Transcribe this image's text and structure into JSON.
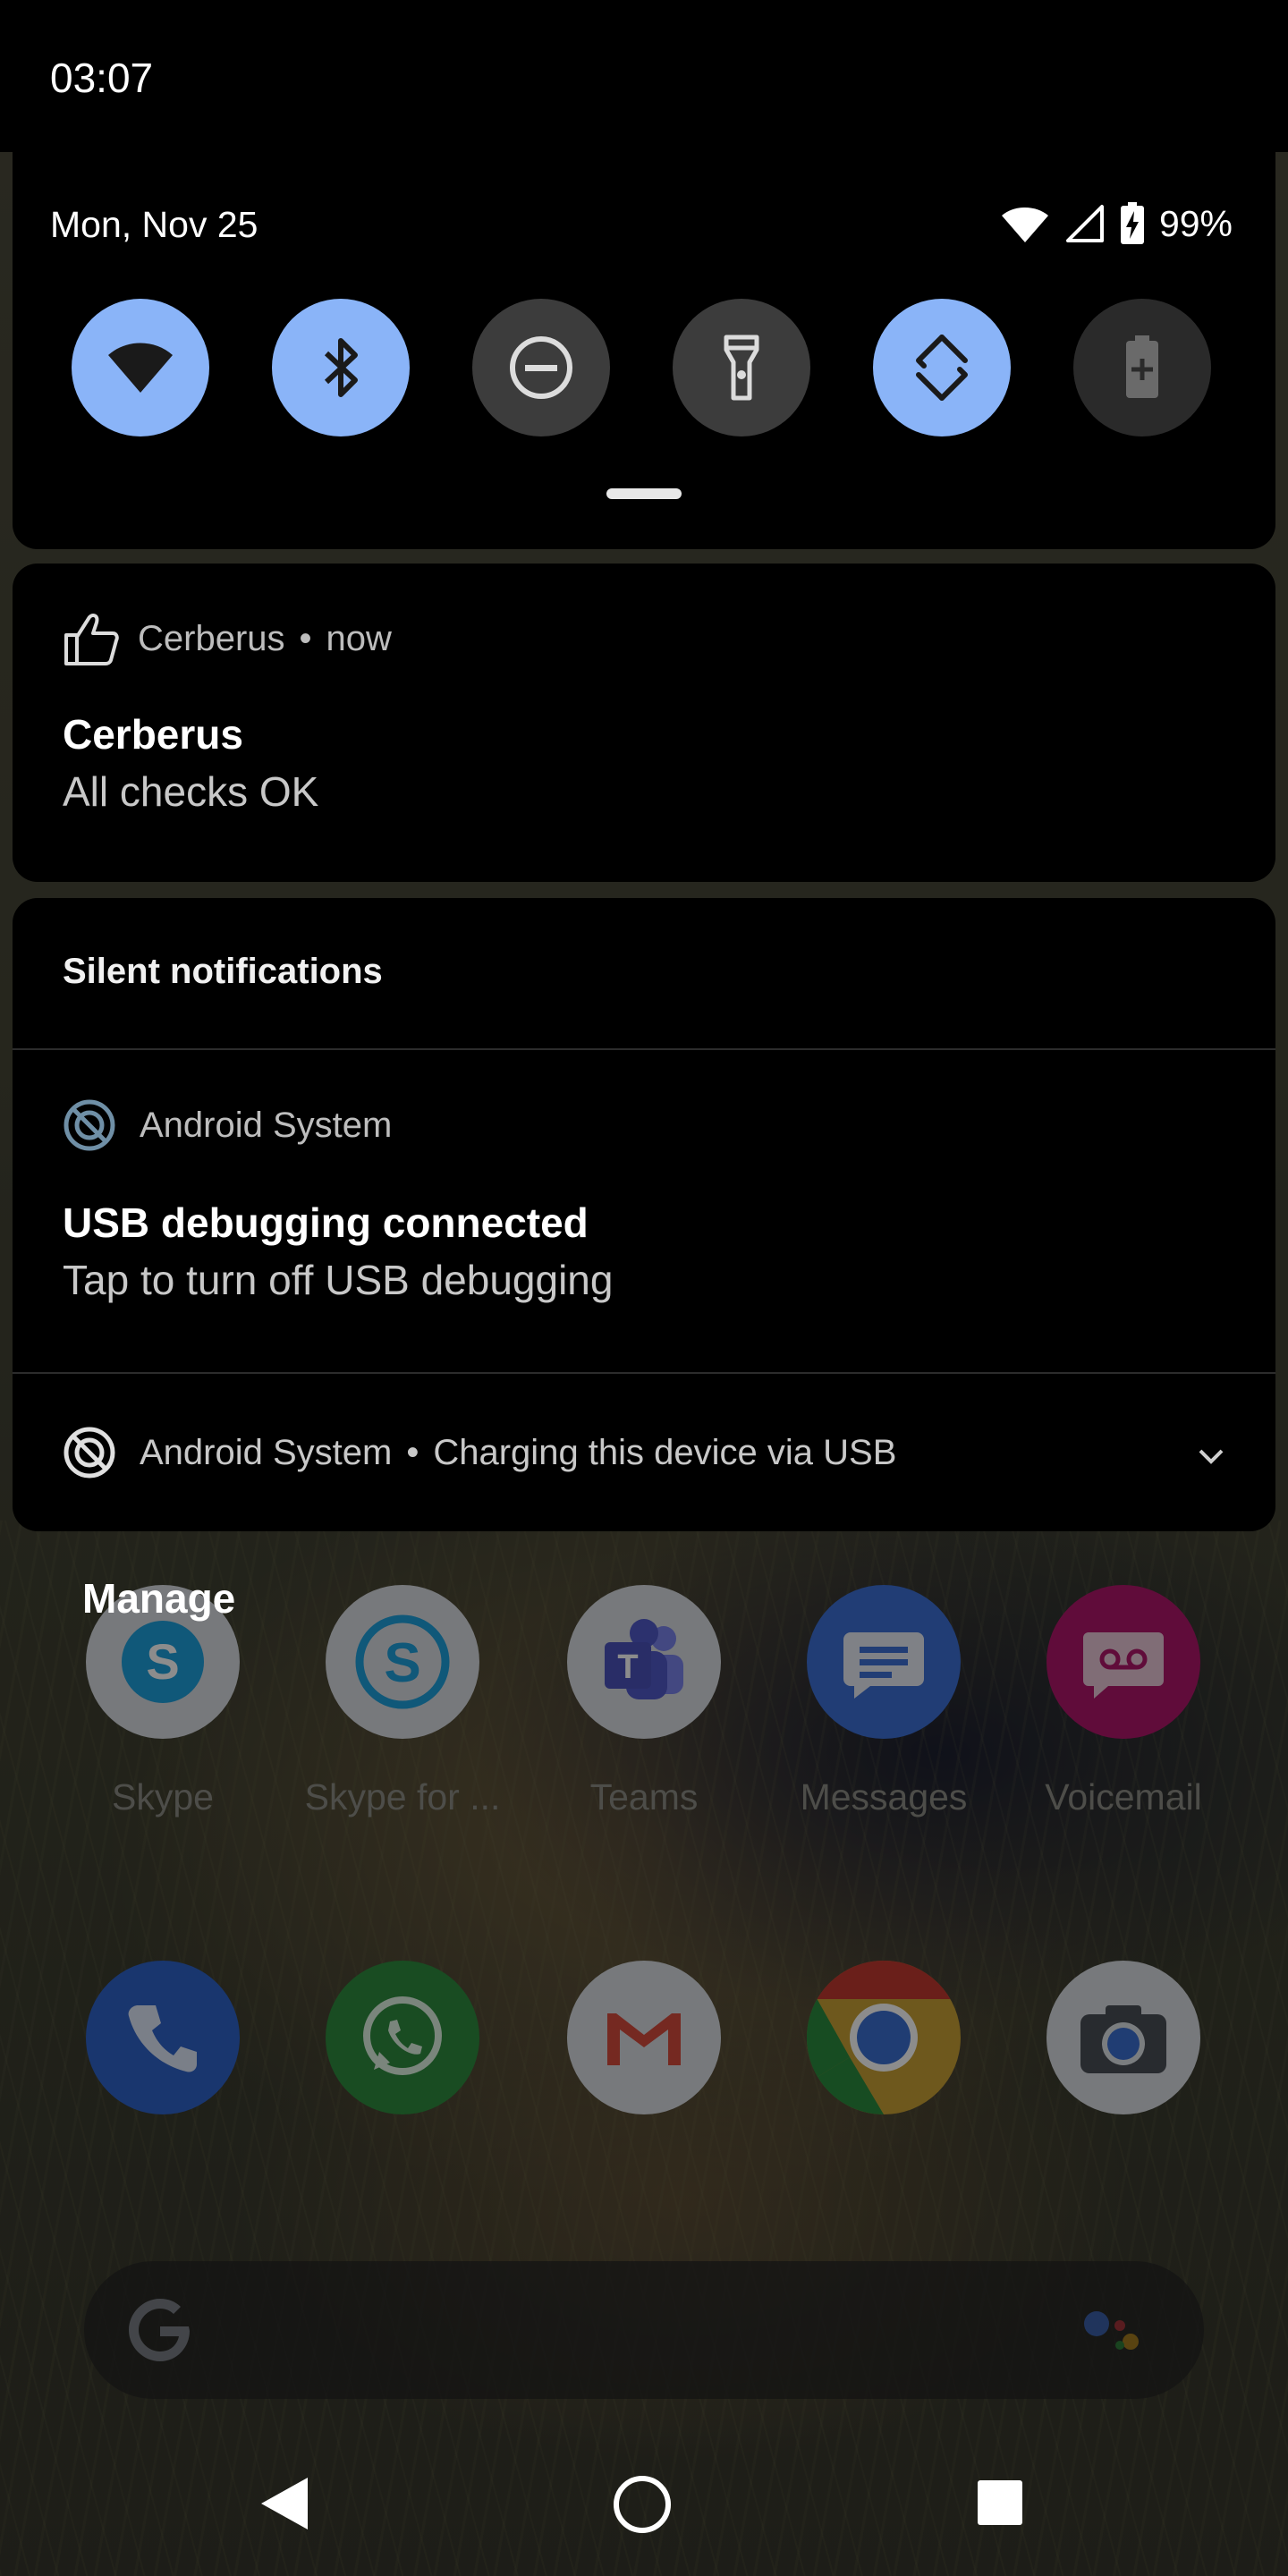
{
  "status_bar": {
    "time": "03:07"
  },
  "quick_settings": {
    "date": "Mon, Nov 25",
    "battery_percent": "99%",
    "tiles": [
      {
        "name": "wifi",
        "state": "on"
      },
      {
        "name": "bluetooth",
        "state": "on"
      },
      {
        "name": "do-not-disturb",
        "state": "off"
      },
      {
        "name": "flashlight",
        "state": "off"
      },
      {
        "name": "auto-rotate",
        "state": "on"
      },
      {
        "name": "battery-saver",
        "state": "disabled"
      }
    ]
  },
  "notifications": {
    "cerberus": {
      "app": "Cerberus",
      "separator": "•",
      "time": "now",
      "title": "Cerberus",
      "text": "All checks OK"
    },
    "silent_header": "Silent notifications",
    "usb_debugging": {
      "app": "Android System",
      "title": "USB debugging connected",
      "text": "Tap to turn off USB debugging"
    },
    "charging": {
      "app": "Android System",
      "separator": "•",
      "text": "Charging this device via USB"
    },
    "manage_label": "Manage"
  },
  "home": {
    "apps": [
      {
        "label": "Skype",
        "icon": "skype-icon"
      },
      {
        "label": "Skype for ...",
        "icon": "skype-for-business-icon"
      },
      {
        "label": "Teams",
        "icon": "teams-icon"
      },
      {
        "label": "Messages",
        "icon": "messages-icon"
      },
      {
        "label": "Voicemail",
        "icon": "voicemail-icon"
      }
    ],
    "dock": [
      "phone-icon",
      "whatsapp-icon",
      "gmail-icon",
      "chrome-icon",
      "camera-icon"
    ],
    "search_bar": {
      "left_icon": "google-g-icon",
      "right_icon": "assistant-icon"
    }
  },
  "colors": {
    "tile_on": "#8ab4f8",
    "tile_off": "#3c3c3c",
    "card_bg": "#000000"
  }
}
